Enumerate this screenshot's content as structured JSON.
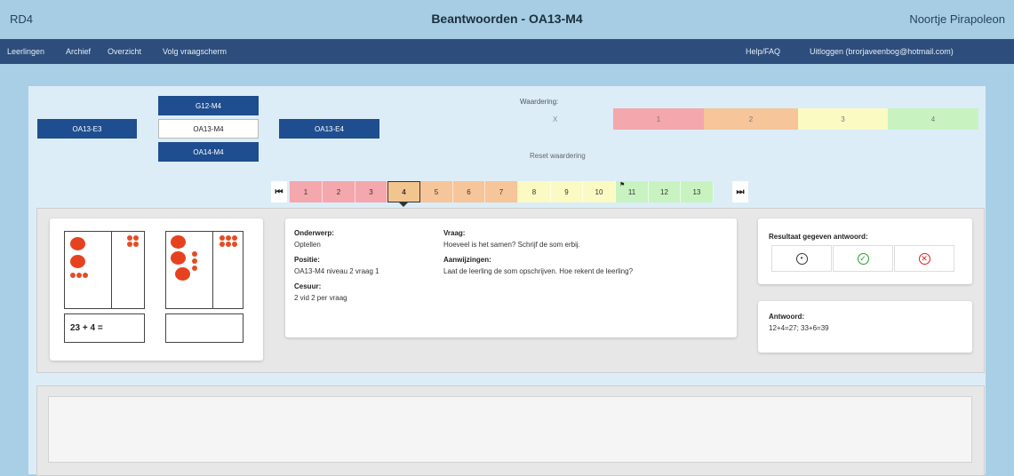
{
  "header": {
    "app": "RD4",
    "title": "Beantwoorden - OA13-M4",
    "user": "Noortje Pirapoleon"
  },
  "menu": {
    "left": [
      "Leerlingen",
      "Archief",
      "Overzicht",
      "Volg vraagscherm"
    ],
    "help": "Help/FAQ",
    "logout": "Uitloggen (brorjaveenbog@hotmail.com)"
  },
  "levels": {
    "left": "OA13-E3",
    "up": "G12-M4",
    "current": "OA13-M4",
    "down": "OA14-M4",
    "right": "OA13-E4"
  },
  "rating": {
    "label": "Waardering:",
    "none": "X",
    "scale": [
      "1",
      "2",
      "3",
      "4"
    ],
    "reset": "Reset waardering"
  },
  "questions": {
    "numbers": [
      "1",
      "2",
      "3",
      "4",
      "5",
      "6",
      "7",
      "8",
      "9",
      "10",
      "11",
      "12",
      "13"
    ],
    "current": "4",
    "first": "⏮",
    "last": "⏭"
  },
  "image": {
    "equation": "23 + 4 ="
  },
  "info": {
    "subject_h": "Onderwerp:",
    "subject": "Optellen",
    "position_h": "Positie:",
    "position": "OA13-M4 niveau 2 vraag 1",
    "cesuur_h": "Cesuur:",
    "cesuur": "2 vid 2 per vraag",
    "question_h": "Vraag:",
    "question": "Hoeveel is het samen? Schrijf de som erbij.",
    "hints_h": "Aanwijzingen:",
    "hints": "Laat de leerling de som opschrijven. Hoe rekent de leerling?"
  },
  "result": {
    "label": "Resultaat gegeven antwoord:"
  },
  "answer": {
    "label": "Antwoord:",
    "value": "12+4=27; 33+6=39"
  },
  "colors": {
    "red": "#f4a7ad",
    "orange": "#f6c59a",
    "yellow": "#fbfac3",
    "green": "#c8f3c0",
    "accent": "#1e4e8f"
  }
}
